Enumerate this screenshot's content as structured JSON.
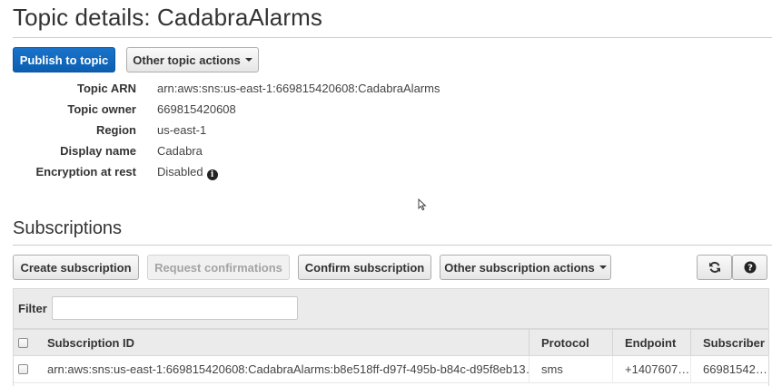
{
  "page": {
    "title": "Topic details: CadabraAlarms"
  },
  "toolbar": {
    "publish_label": "Publish to topic",
    "other_actions_label": "Other topic actions"
  },
  "details": {
    "rows": [
      {
        "label": "Topic ARN",
        "value": "arn:aws:sns:us-east-1:669815420608:CadabraAlarms"
      },
      {
        "label": "Topic owner",
        "value": "669815420608"
      },
      {
        "label": "Region",
        "value": "us-east-1"
      },
      {
        "label": "Display name",
        "value": "Cadabra"
      },
      {
        "label": "Encryption at rest",
        "value": "Disabled"
      }
    ]
  },
  "subscriptions": {
    "title": "Subscriptions",
    "buttons": {
      "create": "Create subscription",
      "request": "Request confirmations",
      "confirm": "Confirm subscription",
      "other": "Other subscription actions"
    },
    "filter": {
      "label": "Filter",
      "value": "",
      "placeholder": ""
    },
    "table": {
      "columns": [
        "Subscription ID",
        "Protocol",
        "Endpoint",
        "Subscriber"
      ],
      "rows": [
        {
          "subscription_id": "arn:aws:sns:us-east-1:669815420608:CadabraAlarms:b8e518ff-d97f-495b-b84c-d95f8eb13…",
          "protocol": "sms",
          "endpoint": "+1407607…",
          "subscriber": "66981542…"
        }
      ]
    }
  },
  "icons": {
    "info": "info-icon",
    "refresh": "refresh-icon",
    "help": "help-icon",
    "cursor": "mouse-cursor-icon"
  },
  "colors": {
    "primary": "#0f67be",
    "text": "#333333",
    "header_bg": "#ebebeb"
  }
}
